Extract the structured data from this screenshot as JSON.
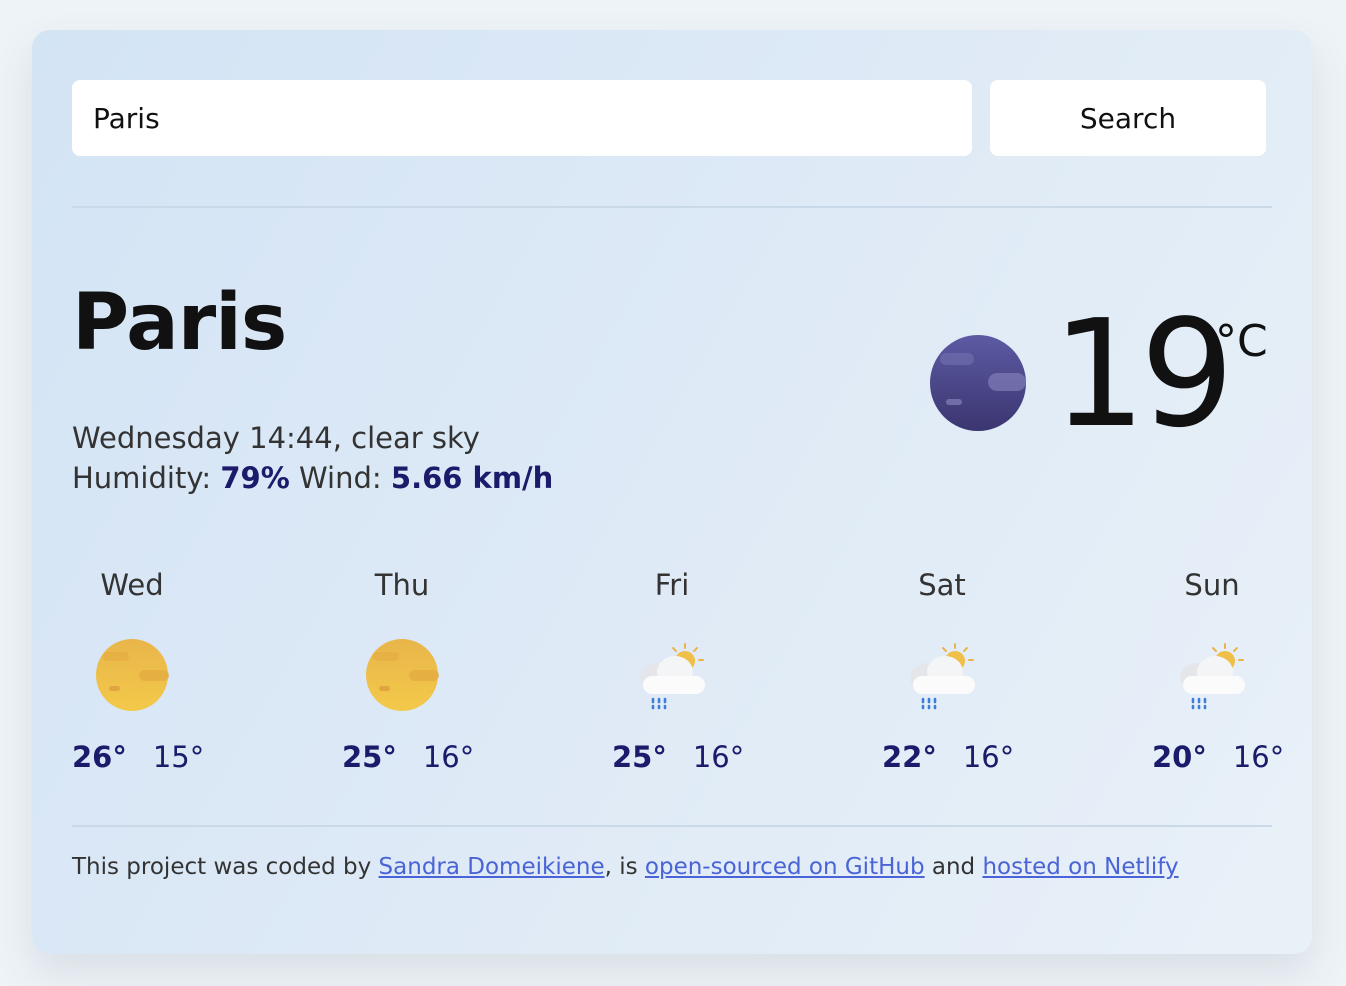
{
  "search": {
    "value": "Paris",
    "button_label": "Search"
  },
  "current": {
    "city": "Paris",
    "description_line": "Wednesday 14:44, clear sky",
    "humidity_label": "Humidity:",
    "humidity_value": "79%",
    "wind_label": "Wind:",
    "wind_value": "5.66 km/h",
    "temperature": "19",
    "unit": "°C",
    "icon": "night-clear-icon"
  },
  "forecast": [
    {
      "day": "Wed",
      "max": "26°",
      "min": "15°",
      "icon": "clear-sun-icon"
    },
    {
      "day": "Thu",
      "max": "25°",
      "min": "16°",
      "icon": "clear-sun-icon"
    },
    {
      "day": "Fri",
      "max": "25°",
      "min": "16°",
      "icon": "rain-cloud-sun-icon"
    },
    {
      "day": "Sat",
      "max": "22°",
      "min": "16°",
      "icon": "rain-cloud-sun-icon"
    },
    {
      "day": "Sun",
      "max": "20°",
      "min": "16°",
      "icon": "rain-cloud-sun-icon"
    }
  ],
  "footer": {
    "text1": "This project was coded by ",
    "link1": "Sandra Domeikiene",
    "text2": ", is ",
    "link2": "open-sourced on GitHub",
    "text3": " and ",
    "link3": "hosted on Netlify"
  },
  "colors": {
    "accent": "#1b1a6b",
    "link": "#4a63d6"
  }
}
